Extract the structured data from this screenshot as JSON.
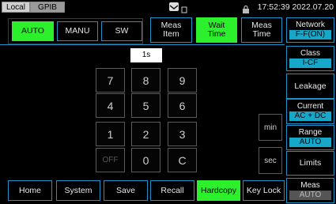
{
  "status": {
    "local": "Local",
    "gpib": "GPIB",
    "datetime": "17:52:39 2022.07.20"
  },
  "modes": {
    "auto": "AUTO",
    "manu": "MANU",
    "sw": "SW"
  },
  "tabs": {
    "meas_item": "Meas\nItem",
    "wait_time": "Wait\nTime",
    "meas_time": "Meas\nTime"
  },
  "entry": {
    "value": "1s"
  },
  "keypad": {
    "k7": "7",
    "k8": "8",
    "k9": "9",
    "k4": "4",
    "k5": "5",
    "k6": "6",
    "k1": "1",
    "k2": "2",
    "k3": "3",
    "off": "OFF",
    "k0": "0",
    "clear": "C"
  },
  "units": {
    "min": "min",
    "sec": "sec"
  },
  "side": {
    "network_label": "Network",
    "network_value": "F-F(ON)",
    "class_label": "Class",
    "class_value": "I-CF",
    "leakage": "Leakage",
    "current_label": "Current",
    "current_value": "AC + DC",
    "range_label": "Range",
    "range_value": "AUTO",
    "limits": "Limits",
    "meas_label": "Meas",
    "meas_value": "AUTO"
  },
  "bottom": {
    "home": "Home",
    "system": "System",
    "save": "Save",
    "recall": "Recall",
    "hardcopy": "Hardcopy",
    "keylock": "Key Lock"
  },
  "colors": {
    "accent_green": "#2bf02b",
    "frame_blue": "#1e90c8",
    "value_cyan": "#17a7c8"
  }
}
